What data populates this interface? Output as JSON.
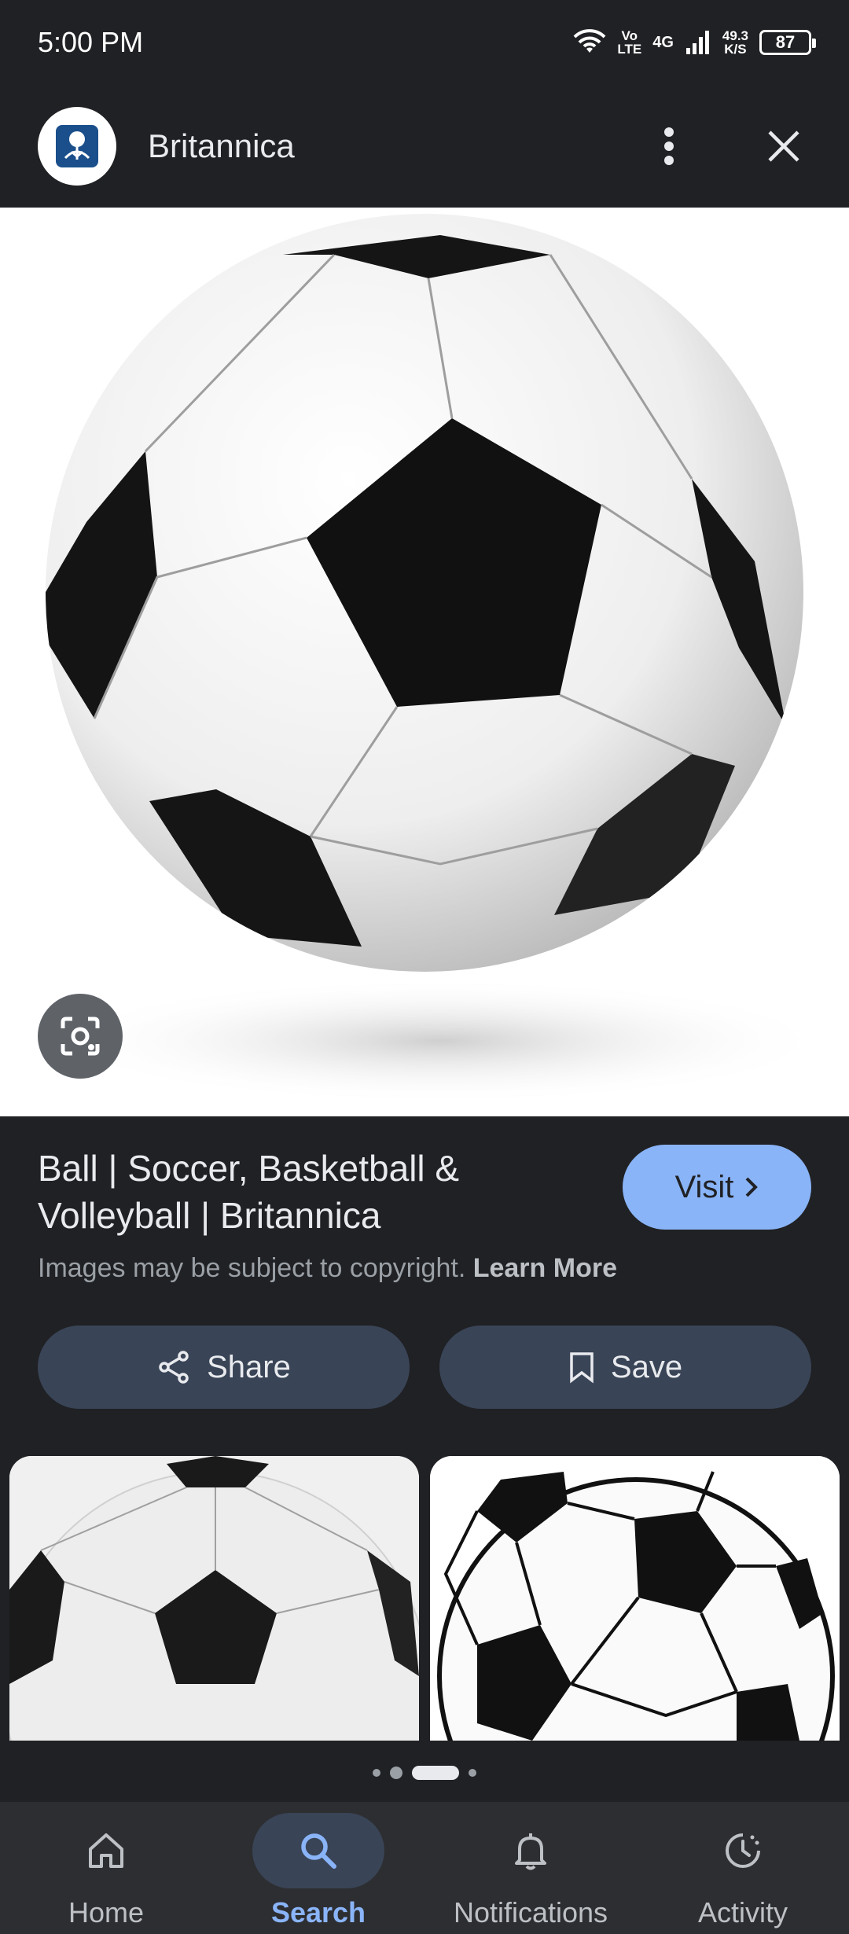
{
  "status_bar": {
    "time": "5:00 PM",
    "volte_line1": "Vo",
    "volte_line2": "LTE",
    "network": "4G",
    "speed_line1": "49.3",
    "speed_line2": "K/S",
    "battery": "87"
  },
  "header": {
    "site_name": "Britannica",
    "logo_icon": "britannica-thistle-logo",
    "more_icon": "more-vert-icon",
    "close_icon": "close-icon"
  },
  "result": {
    "title": "Ball | Soccer, Basketball & Volleyball | Britannica",
    "visit_label": "Visit",
    "copyright_text": "Images may be subject to copyright.",
    "learn_more_label": "Learn More"
  },
  "actions": {
    "share_label": "Share",
    "save_label": "Save"
  },
  "bottom_nav": {
    "items": [
      {
        "label": "Home",
        "icon": "home-icon",
        "active": false
      },
      {
        "label": "Search",
        "icon": "search-icon",
        "active": true
      },
      {
        "label": "Notifications",
        "icon": "bell-icon",
        "active": false
      },
      {
        "label": "Activity",
        "icon": "activity-icon",
        "active": false
      }
    ]
  },
  "colors": {
    "background": "#202124",
    "accent": "#8ab4f8",
    "button_surface": "#394457"
  }
}
